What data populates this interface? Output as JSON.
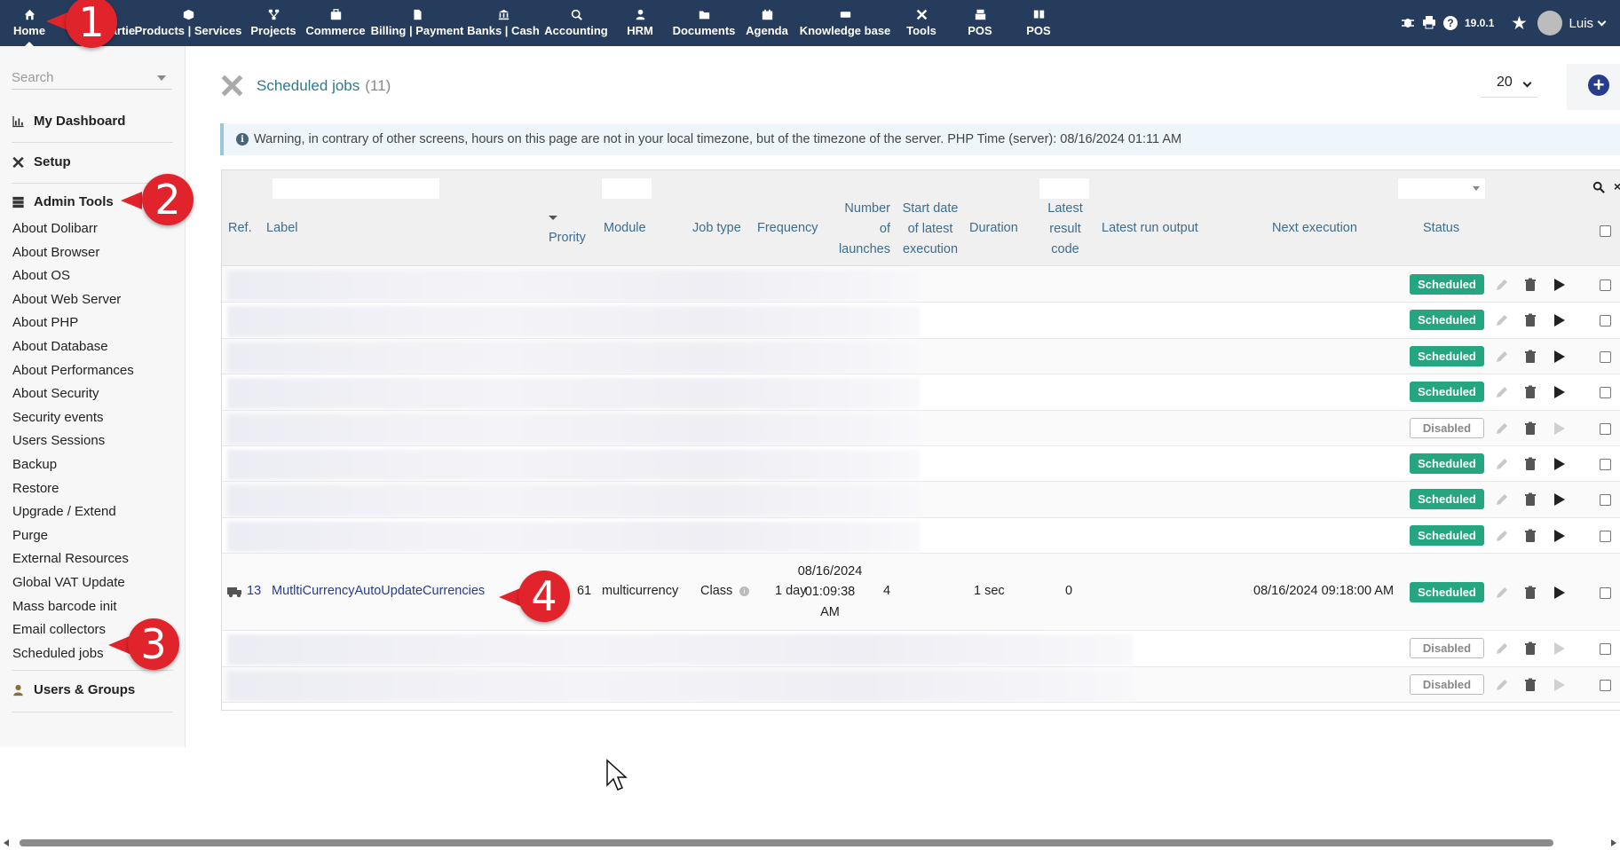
{
  "topbar": {
    "items": [
      {
        "label": "Home",
        "icon": "home-icon"
      },
      {
        "label": "Third parties",
        "icon": "users-icon"
      },
      {
        "label": "Products | Services",
        "icon": "cube-icon"
      },
      {
        "label": "Projects",
        "icon": "sitemap-icon"
      },
      {
        "label": "Commerce",
        "icon": "briefcase-icon"
      },
      {
        "label": "Billing | Payment",
        "icon": "file-invoice-icon"
      },
      {
        "label": "Banks | Cash",
        "icon": "bank-icon"
      },
      {
        "label": "Accounting",
        "icon": "search-dollar-icon"
      },
      {
        "label": "HRM",
        "icon": "user-tie-icon"
      },
      {
        "label": "Documents",
        "icon": "folder-icon"
      },
      {
        "label": "Agenda",
        "icon": "calendar-icon"
      },
      {
        "label": "Knowledge base",
        "icon": "ticket-icon"
      },
      {
        "label": "Tools",
        "icon": "tools-icon"
      },
      {
        "label": "POS",
        "icon": "cash-register-icon"
      },
      {
        "label": "POS",
        "icon": "pos-icon"
      }
    ],
    "version": "19.0.1",
    "user": "Luis"
  },
  "sidebar": {
    "search_placeholder": "Search",
    "dashboard": "My Dashboard",
    "setup": "Setup",
    "admin_tools": "Admin Tools",
    "items": [
      "About Dolibarr",
      "About Browser",
      "About OS",
      "About Web Server",
      "About PHP",
      "About Database",
      "About Performances",
      "About Security",
      "Security events",
      "Users Sessions",
      "Backup",
      "Restore",
      "Upgrade / Extend",
      "Purge",
      "External Resources",
      "Global VAT Update",
      "Mass barcode init",
      "Email collectors",
      "Scheduled jobs"
    ],
    "users_groups": "Users & Groups"
  },
  "page": {
    "title": "Scheduled jobs",
    "count": "(11)",
    "per_page": "20",
    "warning": "Warning, in contrary of other screens, hours on this page are not in your local timezone, but of the timezone of the server. PHP Time (server): 08/16/2024 01:11 AM"
  },
  "table": {
    "headers": {
      "ref": "Ref.",
      "label": "Label",
      "priority": "Prority",
      "module": "Module",
      "job_type": "Job type",
      "frequency": "Frequency",
      "launches_1": "Number",
      "launches_2": "of",
      "launches_3": "launches",
      "start_1": "Start date",
      "start_2": "of latest",
      "start_3": "execution",
      "duration": "Duration",
      "result_1": "Latest",
      "result_2": "result",
      "result_3": "code",
      "output": "Latest run output",
      "next": "Next execution",
      "status": "Status"
    },
    "rows_status": [
      "Scheduled",
      "Scheduled",
      "Scheduled",
      "Scheduled",
      "Disabled",
      "Scheduled",
      "Scheduled",
      "Scheduled"
    ],
    "visible_row": {
      "ref": "13",
      "label": "MutltiCurrencyAutoUpdateCurrencies",
      "priority": "61",
      "module": "multicurrency",
      "job_type": "Class",
      "frequency": "1 day",
      "launches": "4",
      "start_1": "08/16/2024",
      "start_2": "01:09:38",
      "start_3": "AM",
      "duration": "1 sec",
      "result": "0",
      "next": "08/16/2024 09:18:00 AM",
      "status": "Scheduled"
    },
    "bottom_status": [
      "Disabled",
      "Disabled"
    ]
  },
  "annotations": [
    "1",
    "2",
    "3",
    "4"
  ],
  "colors": {
    "topbar": "#263c5c",
    "scheduled": "#25a580",
    "accent": "#e1242b",
    "link": "#263c8c"
  }
}
